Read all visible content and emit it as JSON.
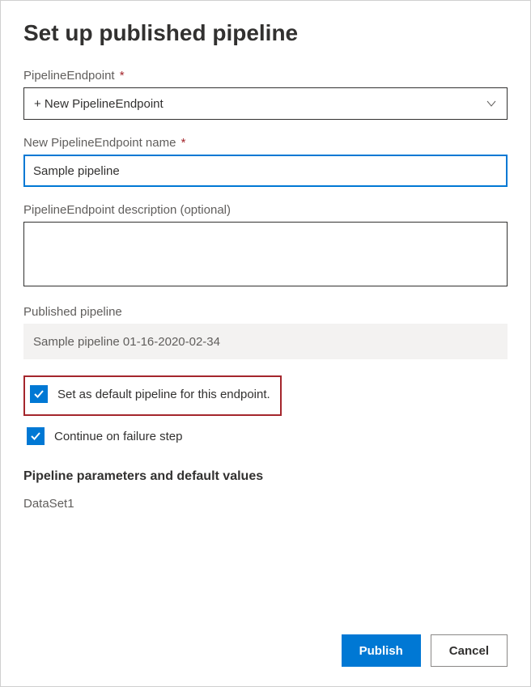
{
  "title": "Set up published pipeline",
  "fields": {
    "endpoint": {
      "label": "PipelineEndpoint",
      "required": true,
      "selected": "+ New PipelineEndpoint"
    },
    "endpointName": {
      "label": "New PipelineEndpoint name",
      "required": true,
      "value": "Sample pipeline"
    },
    "description": {
      "label": "PipelineEndpoint description (optional)",
      "value": ""
    },
    "publishedPipeline": {
      "label": "Published pipeline",
      "value": "Sample pipeline 01-16-2020-02-34"
    }
  },
  "checkboxes": {
    "setDefault": {
      "label": "Set as default pipeline for this endpoint.",
      "checked": true
    },
    "continueOnFailure": {
      "label": "Continue on failure step",
      "checked": true
    }
  },
  "paramsSection": {
    "title": "Pipeline parameters and default values",
    "params": [
      {
        "name": "DataSet1"
      }
    ]
  },
  "buttons": {
    "publish": "Publish",
    "cancel": "Cancel"
  },
  "requiredMark": "*"
}
